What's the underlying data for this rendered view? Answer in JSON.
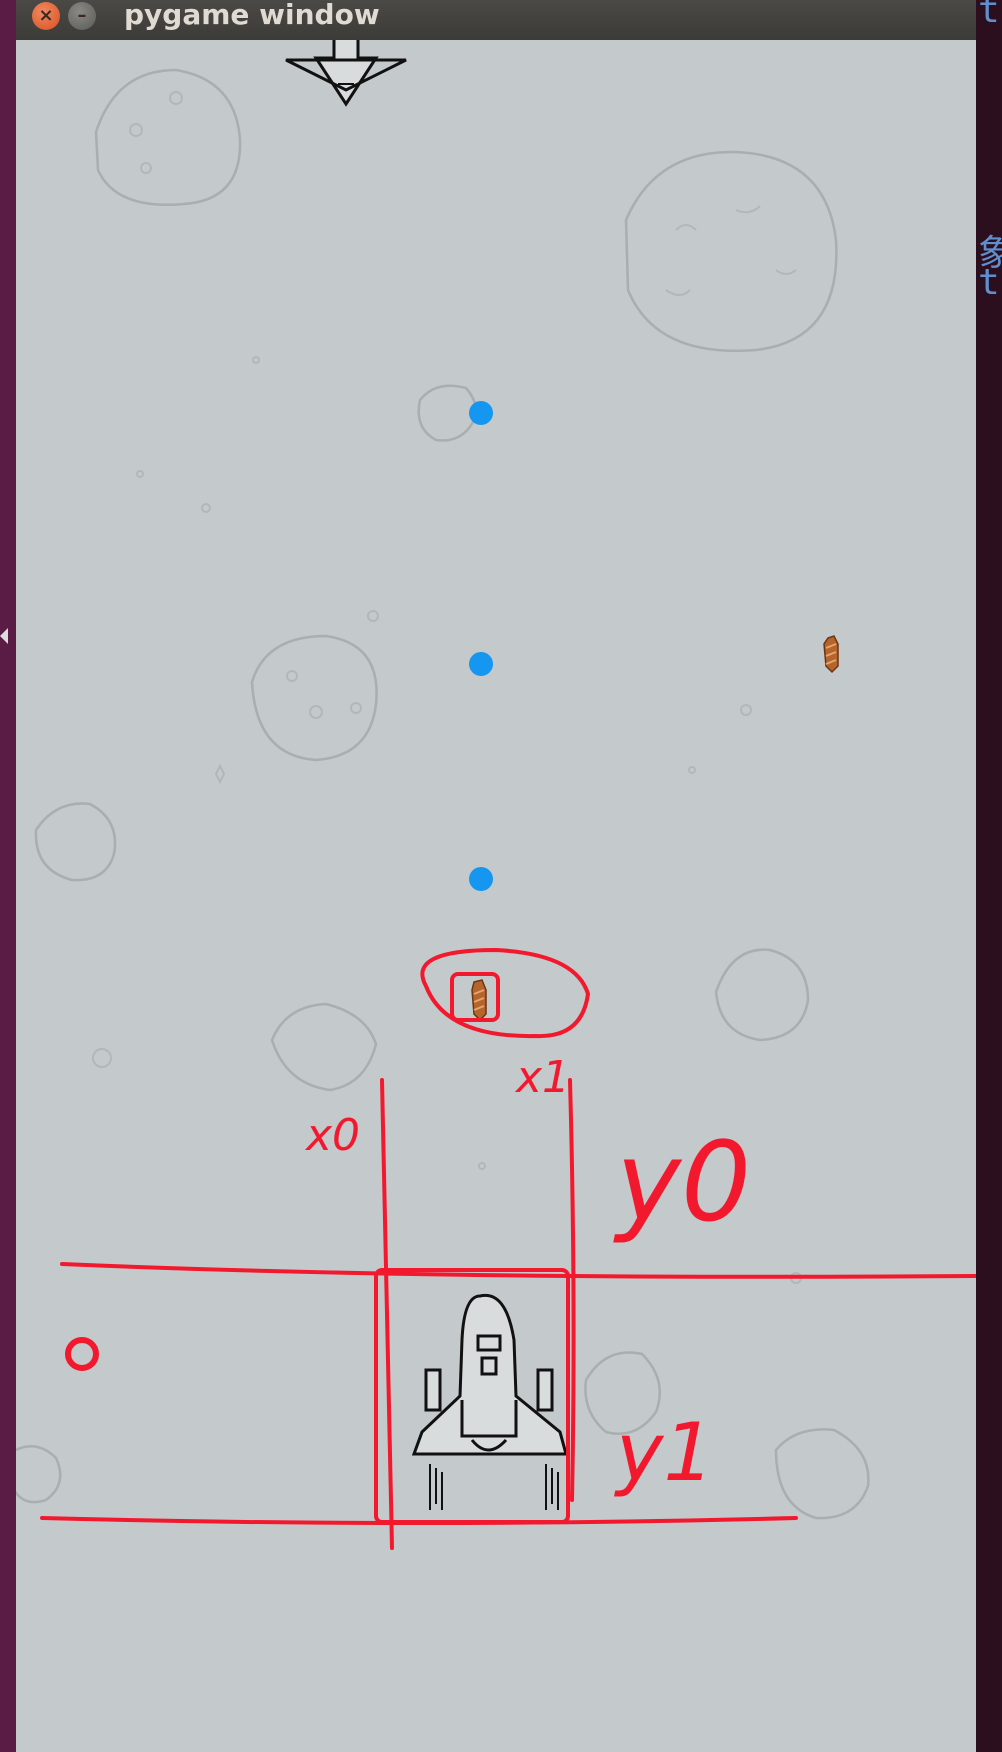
{
  "window": {
    "title": "pygame window",
    "close_symbol": "×",
    "minimize_symbol": "–"
  },
  "background_desktop": {
    "right_edge_fragments": [
      "t",
      "象",
      "t"
    ]
  },
  "colors": {
    "canvas_background": "#c4c9cb",
    "bullet": "#1596f0",
    "missile": "#b5652c",
    "annotation": "#f2192f",
    "titlebar": "#3c3b37",
    "desktop": "#5a1b45"
  },
  "sprites": {
    "player_ship": "player-spaceship",
    "enemy_ship": "enemy-spaceship",
    "bullets": [
      "bullet-blue",
      "bullet-blue",
      "bullet-blue"
    ],
    "missiles": [
      "missile-orange",
      "missile-orange"
    ],
    "asteroids": 9
  },
  "annotations": {
    "labels": [
      "x0",
      "x1",
      "y0",
      "y1"
    ]
  }
}
